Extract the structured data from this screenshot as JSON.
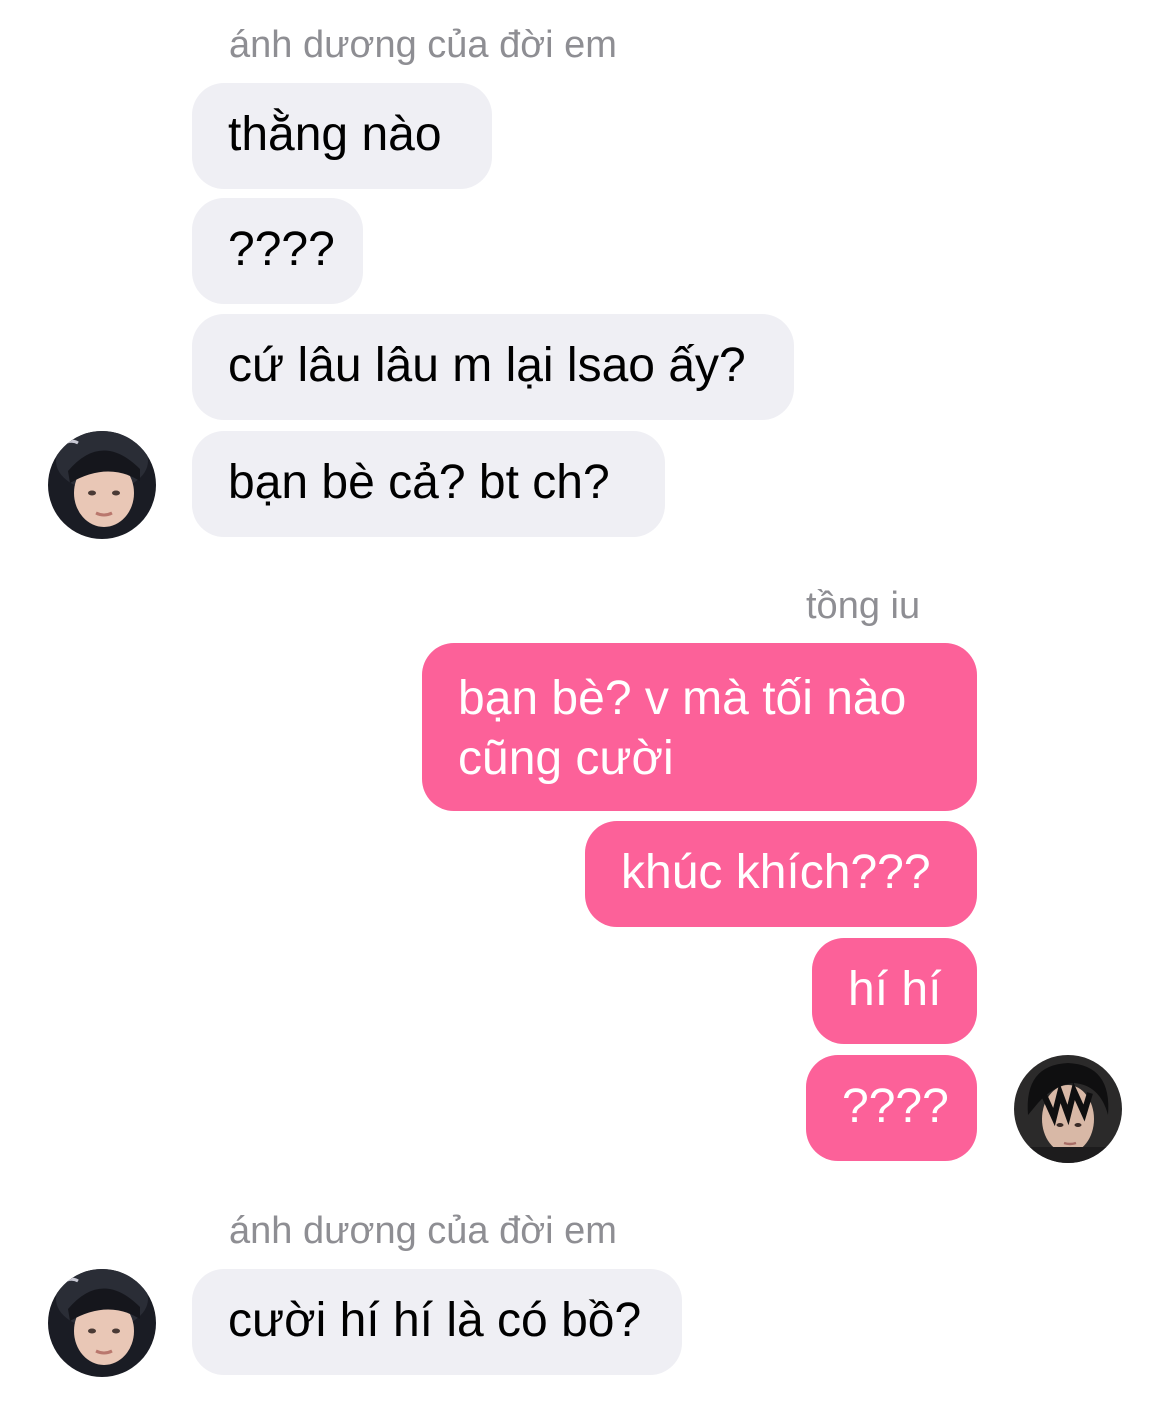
{
  "conversation": {
    "group1": {
      "sender": "ánh dương của đời em",
      "messages": [
        "thằng nào",
        "????",
        "cứ lâu lâu m lại lsao ấy?",
        "bạn bè cả? bt ch?"
      ]
    },
    "group2": {
      "sender": "tồng iu",
      "messages": [
        "bạn bè? v mà tối nào cũng cười",
        "khúc khích???",
        "hí hí",
        "????"
      ]
    },
    "group3": {
      "sender": "ánh dương của đời em",
      "messages": [
        "cười hí hí là có bồ?"
      ]
    }
  },
  "colors": {
    "incoming_bubble": "#efeff4",
    "outgoing_bubble": "#fc6199",
    "sender_name": "#8e8e93"
  },
  "icons": {
    "incoming_avatar": "avatar-photo",
    "outgoing_avatar": "avatar-photo"
  }
}
